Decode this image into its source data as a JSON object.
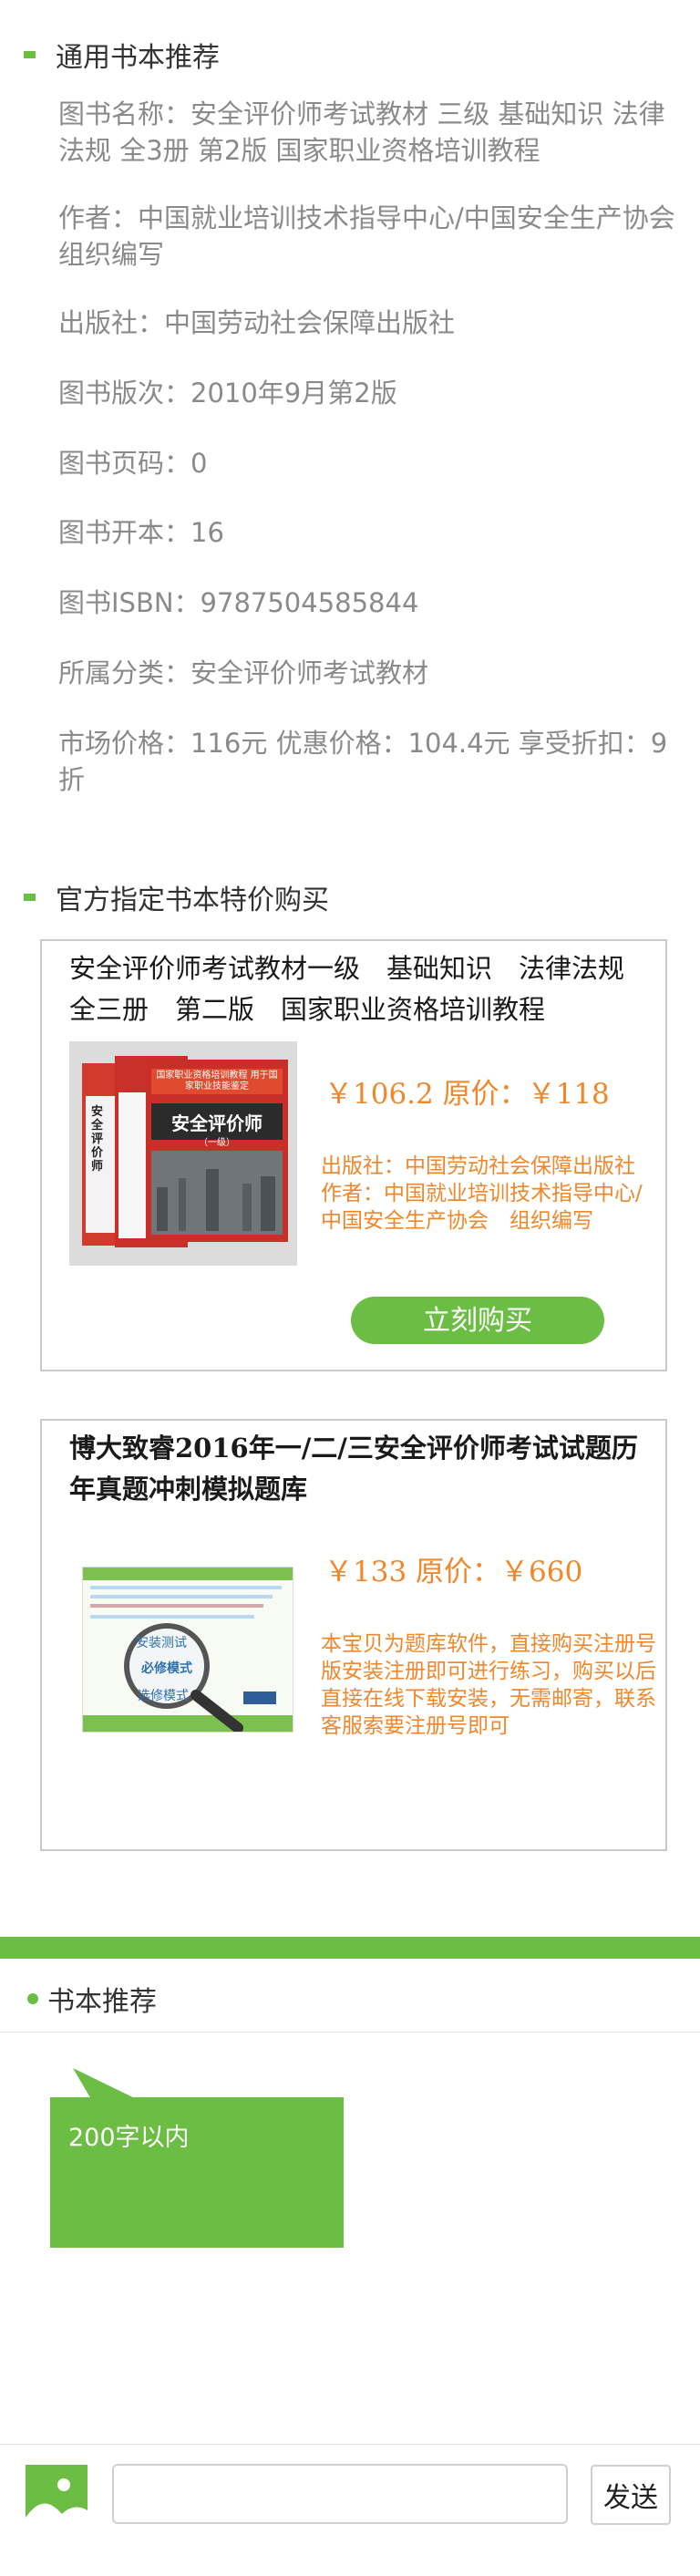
{
  "section_general": {
    "title": "通用书本推荐",
    "book_name": "图书名称：安全评价师考试教材 三级 基础知识 法律法规 全3册 第2版 国家职业资格培训教程",
    "author": "作者：中国就业培训技术指导中心/中国安全生产协会 组织编写",
    "publisher": "出版社：中国劳动社会保障出版社",
    "edition": "图书版次：2010年9月第2版",
    "pages": "图书页码：0",
    "format": "图书开本：16",
    "isbn": "图书ISBN：9787504585844",
    "category": "所属分类：安全评价师考试教材",
    "price_line": "市场价格：116元 优惠价格：104.4元 享受折扣：9折"
  },
  "section_official": {
    "title": "官方指定书本特价购买",
    "cards": [
      {
        "title": "安全评价师考试教材一级　基础知识　法律法规 全三册　第二版　国家职业资格培训教程",
        "price": "￥106.2 原价：￥118",
        "desc": "出版社：中国劳动社会保障出版社\n作者：中国就业培训技术指导中心/中国安全生产协会　组织编写",
        "buy_label": "立刻购买",
        "cover_text": {
          "banner": "国家职业资格培训教程 用于国家职业技能鉴定",
          "main": "安全评价师",
          "level": "（一级）",
          "side": "安全评价师"
        }
      },
      {
        "title": "博大致睿2016年一/二/三安全评价师考试试题历年真题冲刺模拟题库",
        "price": "￥133 原价：￥660",
        "desc": "本宝贝为题库软件，直接购买注册号版安装注册即可进行练习，购买以后直接在线下载安装，无需邮寄，联系客服索要注册号即可",
        "cover_text": {
          "opt1": "安装测试",
          "opt2": "必修模式",
          "opt3": "选修模式"
        }
      }
    ]
  },
  "recommend": {
    "title": "书本推荐",
    "bubble_text": "200字以内"
  },
  "footer": {
    "input_value": "",
    "send_label": "发送"
  },
  "colors": {
    "accent": "#6bbd43",
    "price": "#f0872a"
  }
}
